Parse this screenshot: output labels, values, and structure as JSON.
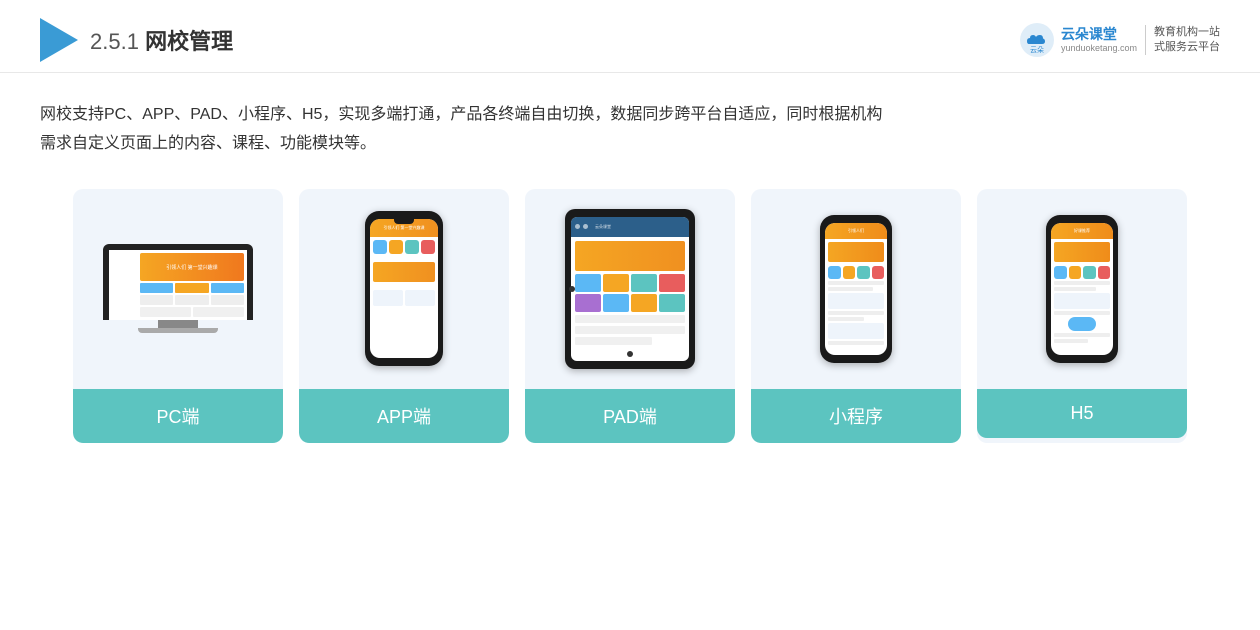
{
  "header": {
    "section_num": "2.5.1",
    "section_name": "网校管理",
    "brand": {
      "name": "云朵课堂",
      "url": "yunduoketang.com",
      "slogan_line1": "教育机构一站",
      "slogan_line2": "式服务云平台"
    }
  },
  "description": {
    "text_line1": "网校支持PC、APP、PAD、小程序、H5，实现多端打通，产品各终端自由切换，数据同步跨平台自适应，同时根据机构",
    "text_line2": "需求自定义页面上的内容、课程、功能模块等。"
  },
  "cards": [
    {
      "id": "pc",
      "label": "PC端"
    },
    {
      "id": "app",
      "label": "APP端"
    },
    {
      "id": "pad",
      "label": "PAD端"
    },
    {
      "id": "miniprogram",
      "label": "小程序"
    },
    {
      "id": "h5",
      "label": "H5"
    }
  ],
  "colors": {
    "card_bg": "#eef4fb",
    "card_label_bg": "#5cc4c0",
    "accent_orange": "#f5a623",
    "accent_blue": "#2c5f8a",
    "title_blue": "#3a9bd5"
  }
}
